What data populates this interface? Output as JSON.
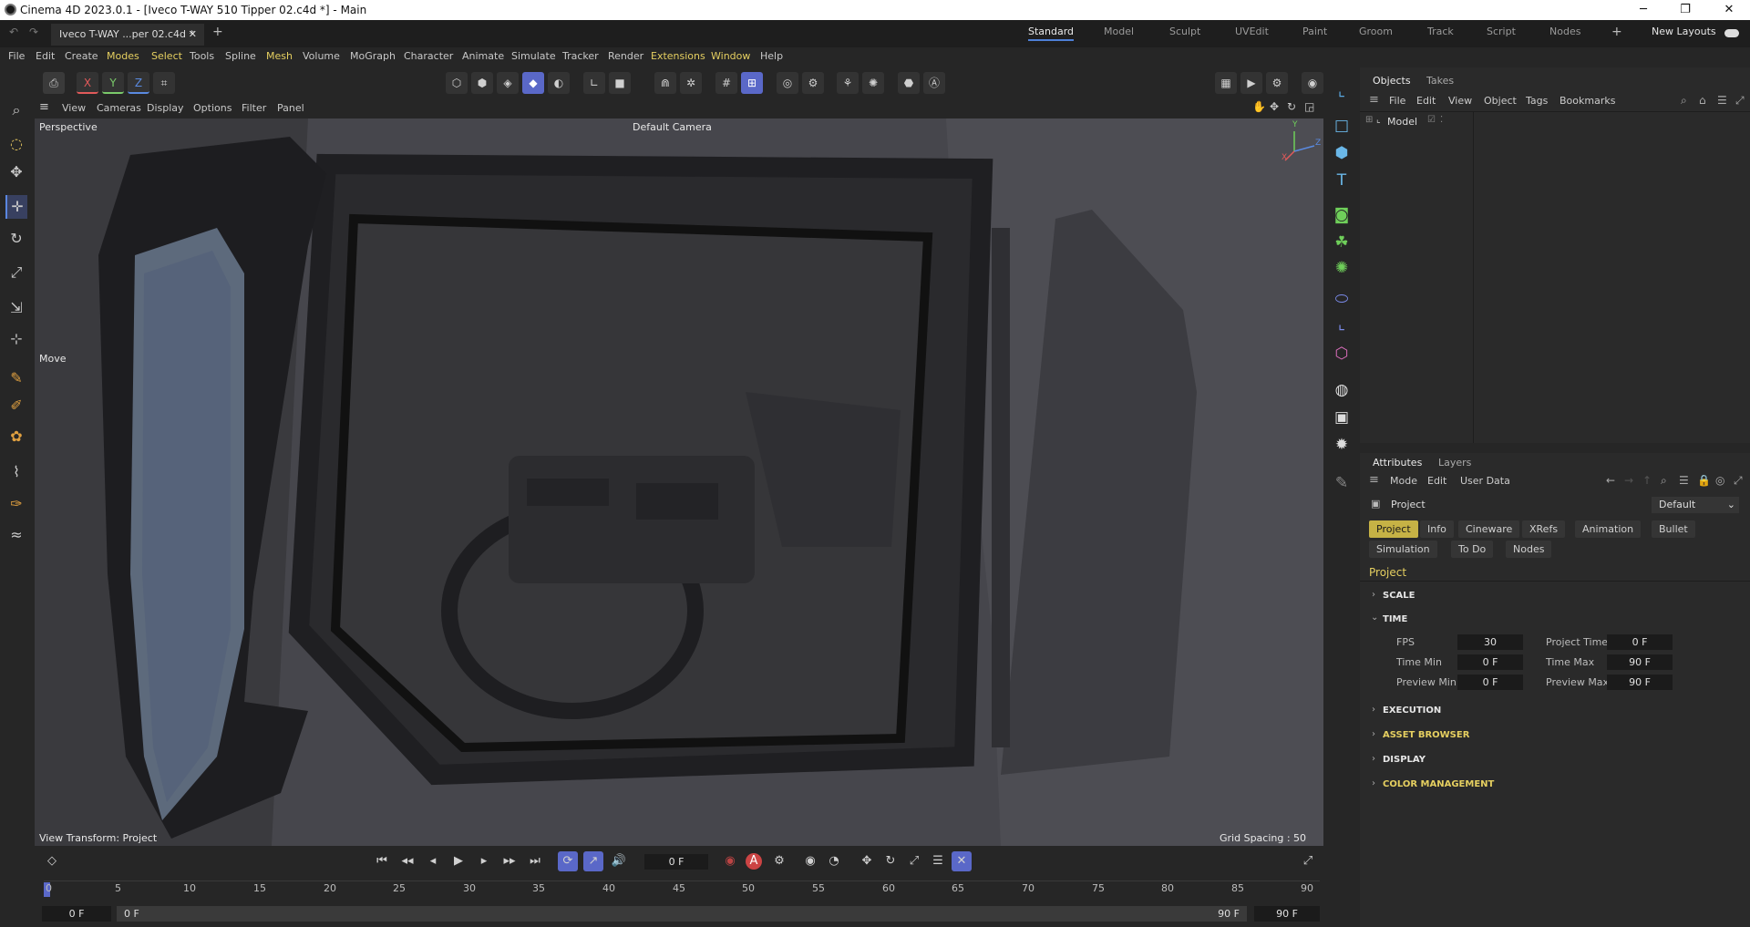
{
  "window": {
    "title": "Cinema 4D 2023.0.1 - [Iveco T-WAY 510 Tipper 02.c4d *] - Main",
    "minimize": "─",
    "maximize": "❐",
    "close": "✕"
  },
  "tabs": {
    "document": "Iveco T-WAY ...per 02.c4d *",
    "close": "✕",
    "add": "+",
    "layouts": [
      "Standard",
      "Model",
      "Sculpt",
      "UVEdit",
      "Paint",
      "Groom",
      "Track",
      "Script",
      "Nodes"
    ],
    "new_layouts": "New Layouts"
  },
  "menu": [
    "File",
    "Edit",
    "Create",
    "Modes",
    "Select",
    "Tools",
    "Spline",
    "Mesh",
    "Volume",
    "MoGraph",
    "Character",
    "Animate",
    "Simulate",
    "Tracker",
    "Render",
    "Extensions",
    "Window",
    "Help"
  ],
  "menu_highlight": [
    "Modes",
    "Mesh",
    "Extensions",
    "Window"
  ],
  "toolbar": {
    "x": "X",
    "y": "Y",
    "z": "Z"
  },
  "viewport": {
    "menu": [
      "View",
      "Cameras",
      "Display",
      "Options",
      "Filter",
      "Panel"
    ],
    "perspective": "Perspective",
    "camera": "Default Camera",
    "move_label": "Move",
    "view_transform": "View Transform: Project",
    "grid_spacing": "Grid Spacing : 50 cm",
    "axis": {
      "y": "Y",
      "x": "X",
      "z": "Z"
    }
  },
  "timeline": {
    "current_frame": "0 F",
    "ticks": [
      "0",
      "5",
      "10",
      "15",
      "20",
      "25",
      "30",
      "35",
      "40",
      "45",
      "50",
      "55",
      "60",
      "65",
      "70",
      "75",
      "80",
      "85",
      "90"
    ],
    "start_left": "0 F",
    "start_right": "0 F",
    "end_left": "90 F",
    "end_right": "90 F",
    "record": "A"
  },
  "objects_panel": {
    "tabs": [
      "Objects",
      "Takes"
    ],
    "menu": [
      "File",
      "Edit",
      "View",
      "Object",
      "Tags",
      "Bookmarks"
    ],
    "items": [
      {
        "name": "Model"
      }
    ]
  },
  "attributes_panel": {
    "tabs": [
      "Attributes",
      "Layers"
    ],
    "menu": [
      "Mode",
      "Edit",
      "User Data"
    ],
    "object": "Project",
    "preset": "Default",
    "pills_row1": [
      "Project",
      "Info",
      "Cineware",
      "XRefs",
      "Animation",
      "Bullet"
    ],
    "pills_row2": [
      "Simulation",
      "To Do",
      "Nodes"
    ],
    "heading": "Project",
    "sections": [
      "SCALE",
      "TIME",
      "EXECUTION",
      "ASSET BROWSER",
      "DISPLAY",
      "COLOR MANAGEMENT"
    ],
    "time": {
      "fps_label": "FPS",
      "fps": "30",
      "project_time_label": "Project Time",
      "project_time": "0 F",
      "time_min_label": "Time Min",
      "time_min": "0 F",
      "time_max_label": "Time Max",
      "time_max": "90 F",
      "preview_min_label": "Preview Min",
      "preview_min": "0 F",
      "preview_max_label": "Preview Max",
      "preview_max": "90 F"
    }
  },
  "colors": {
    "accent": "#4d7fd6",
    "highlight": "#e5cf60",
    "active_tool": "#5a68c8",
    "pill_active": "#c6b245"
  }
}
